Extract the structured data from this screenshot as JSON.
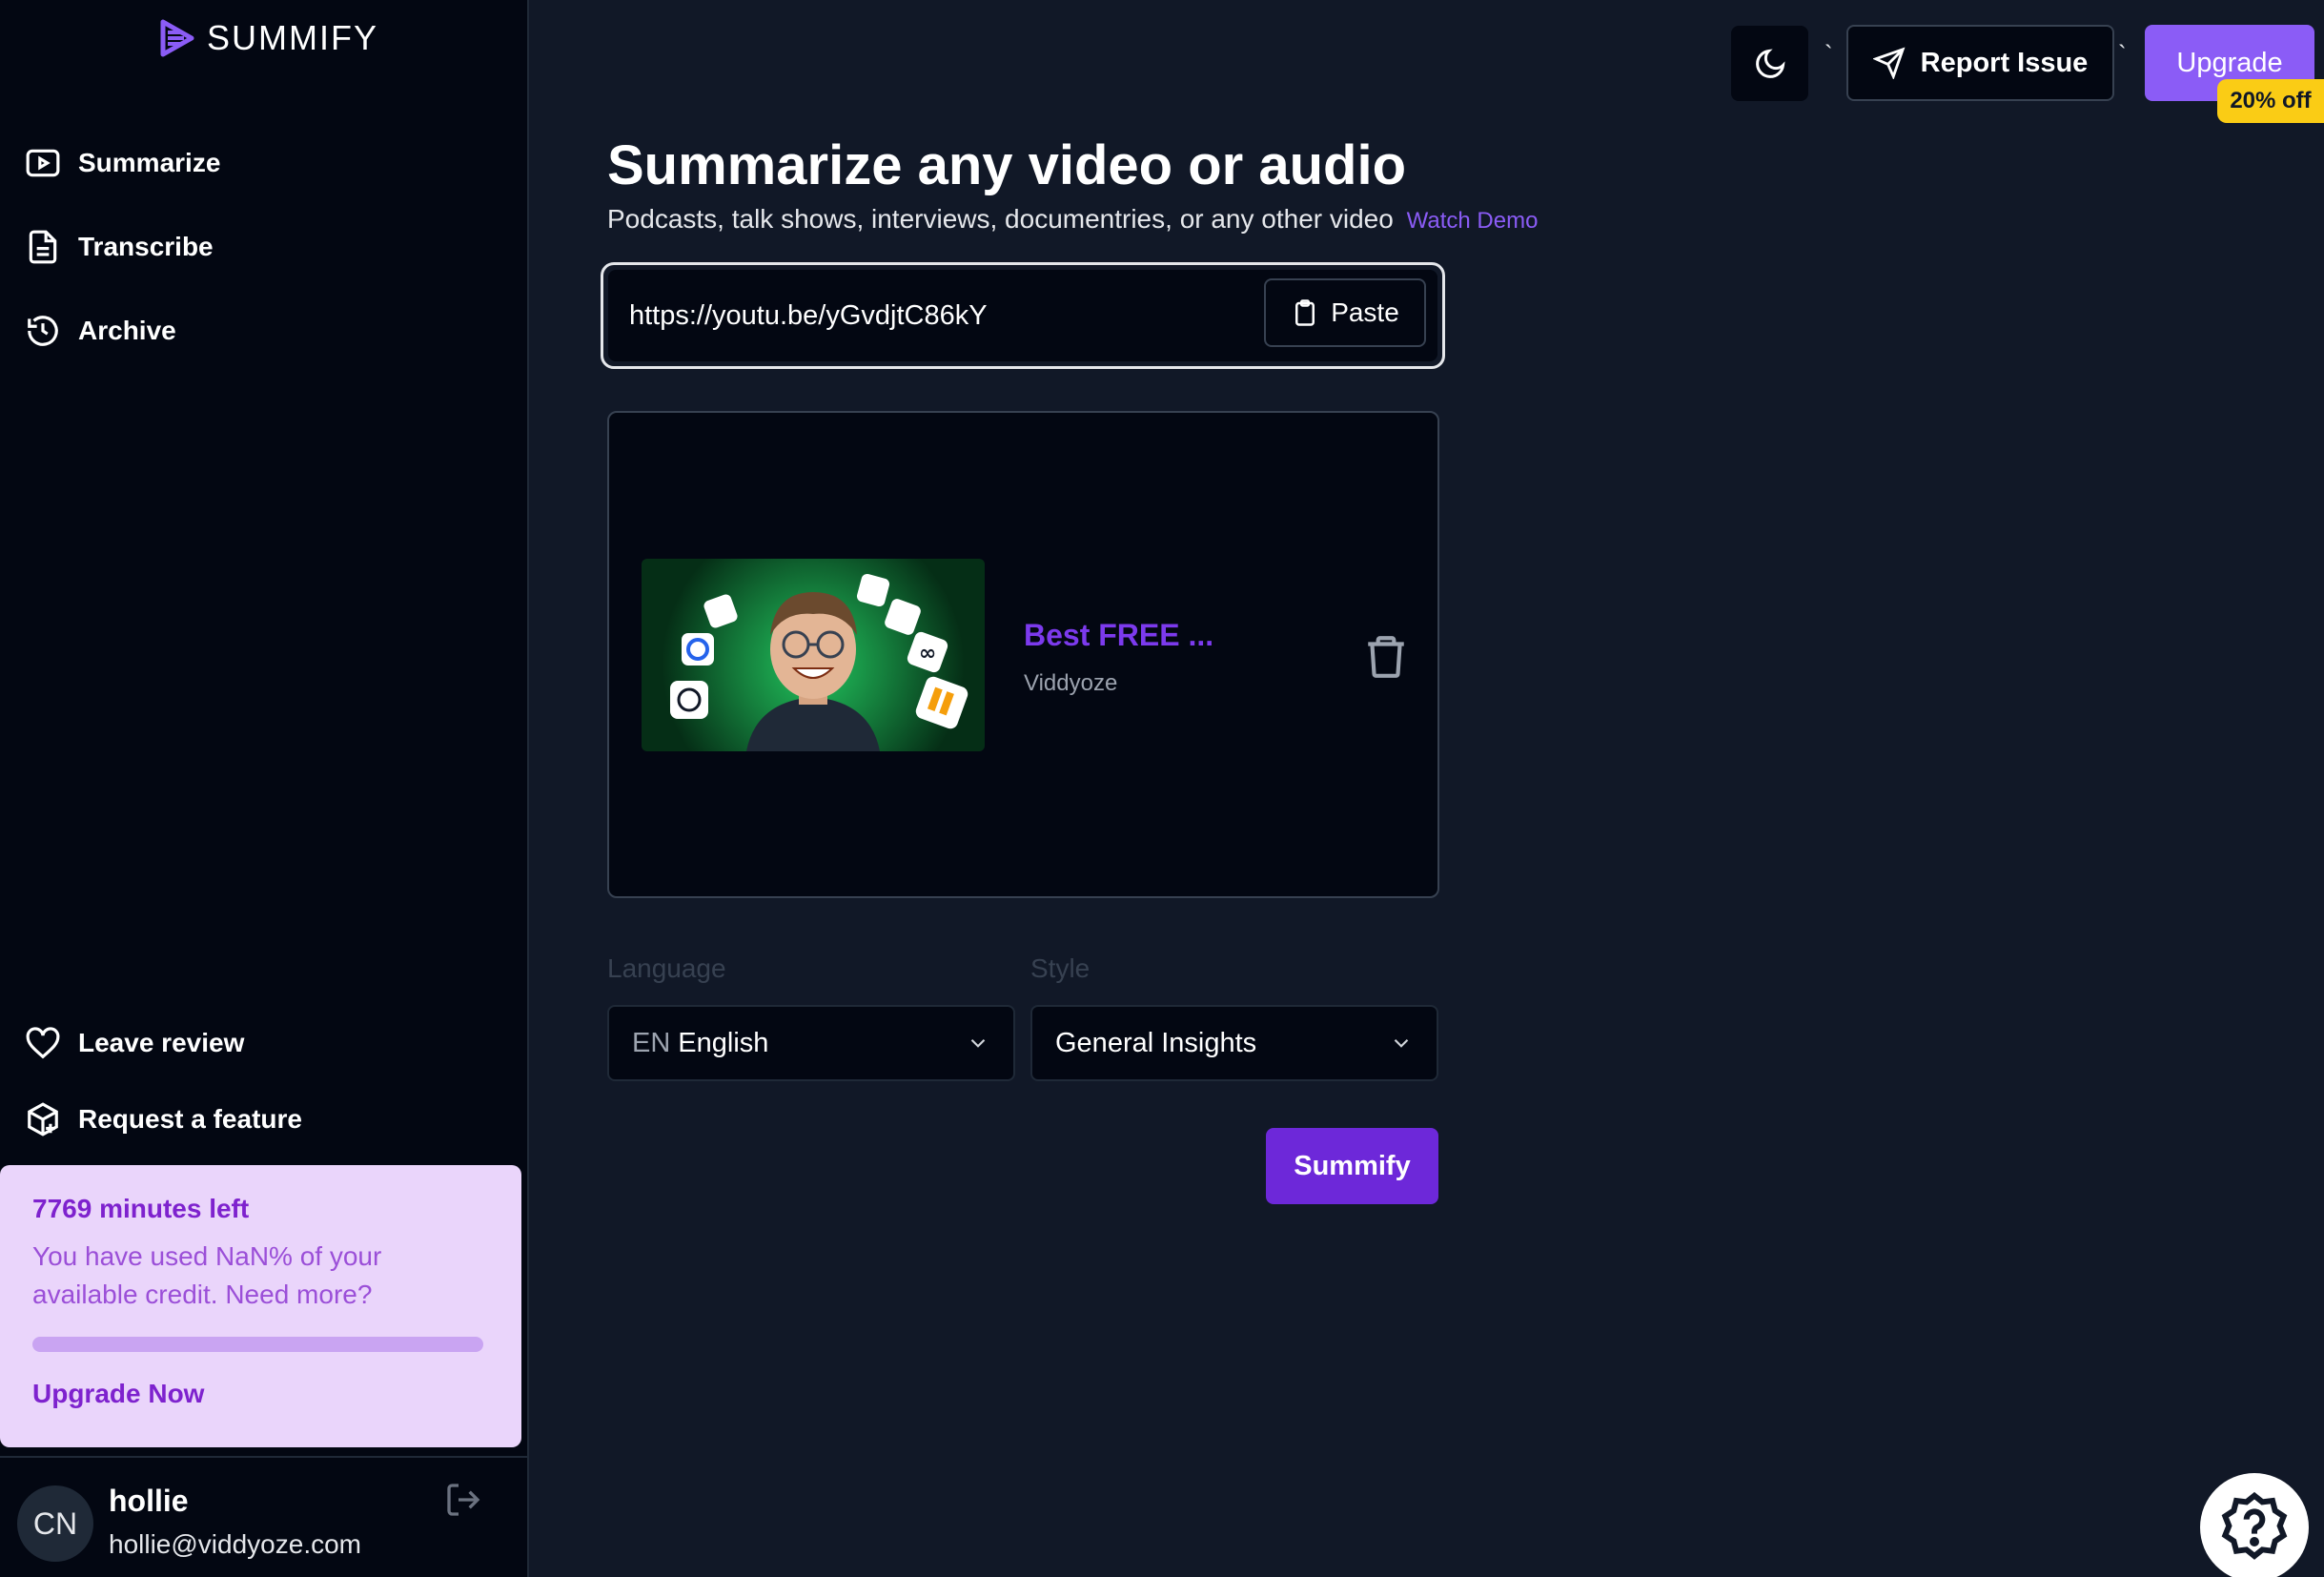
{
  "app": {
    "name": "SUMMIFY",
    "accent_color": "#8b5cf6",
    "background_color": "#111827"
  },
  "sidebar": {
    "nav_items": [
      {
        "label": "Summarize",
        "icon": "play-square-icon"
      },
      {
        "label": "Transcribe",
        "icon": "document-icon"
      },
      {
        "label": "Archive",
        "icon": "history-icon"
      }
    ],
    "bottom_items": [
      {
        "label": "Leave review",
        "icon": "heart-icon"
      },
      {
        "label": "Request a feature",
        "icon": "package-plus-icon"
      }
    ],
    "credit": {
      "minutes_left": "7769 minutes left",
      "description": "You have used NaN% of your available credit. Need more?",
      "link_label": "Upgrade Now"
    },
    "user": {
      "initials": "CN",
      "name": "hollie",
      "email": "hollie@viddyoze.com"
    }
  },
  "header": {
    "separator": "`",
    "report_label": "Report Issue",
    "upgrade_label": "Upgrade",
    "discount_label": "20% off"
  },
  "main": {
    "title": "Summarize any video or audio",
    "subtitle": "Podcasts, talk shows, interviews, documentries, or any other video",
    "watch_demo_label": "Watch Demo",
    "url_value": "https://youtu.be/yGvdjtC86kY",
    "paste_label": "Paste",
    "video": {
      "title": "Best FREE ...",
      "channel": "Viddyoze"
    },
    "language": {
      "label": "Language",
      "code": "EN",
      "value": "English"
    },
    "style": {
      "label": "Style",
      "value": "General Insights"
    },
    "submit_label": "Summify"
  }
}
